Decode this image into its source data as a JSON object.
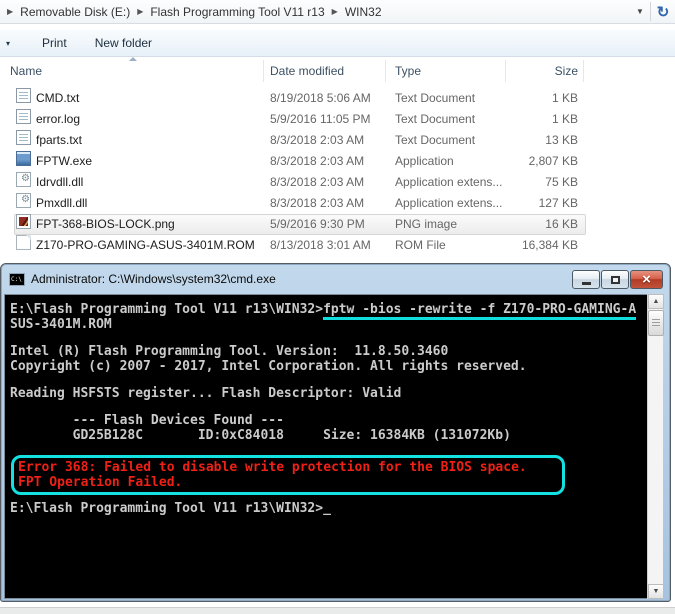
{
  "address_bar": {
    "breadcrumbs": [
      "Removable Disk (E:)",
      "Flash Programming Tool V11 r13",
      "WIN32"
    ]
  },
  "icons": {
    "breadcrumb_arrow": "▶",
    "dropdown": "▼",
    "refresh": "↻",
    "overflow_chevron": "▾",
    "scroll_up": "▲",
    "scroll_down": "▼",
    "close": "×"
  },
  "toolbar": {
    "print": "Print",
    "new_folder": "New folder"
  },
  "list": {
    "columns": [
      "Name",
      "Date modified",
      "Type",
      "Size"
    ],
    "files": [
      {
        "icon": "text",
        "name": "CMD.txt",
        "date": "8/19/2018 5:06 AM",
        "type": "Text Document",
        "size": "1 KB"
      },
      {
        "icon": "text",
        "name": "error.log",
        "date": "5/9/2016 11:05 PM",
        "type": "Text Document",
        "size": "1 KB"
      },
      {
        "icon": "text",
        "name": "fparts.txt",
        "date": "8/3/2018 2:03 AM",
        "type": "Text Document",
        "size": "13 KB"
      },
      {
        "icon": "app",
        "name": "FPTW.exe",
        "date": "8/3/2018 2:03 AM",
        "type": "Application",
        "size": "2,807 KB"
      },
      {
        "icon": "dll",
        "name": "Idrvdll.dll",
        "date": "8/3/2018 2:03 AM",
        "type": "Application extens...",
        "size": "75 KB"
      },
      {
        "icon": "dll",
        "name": "Pmxdll.dll",
        "date": "8/3/2018 2:03 AM",
        "type": "Application extens...",
        "size": "127 KB"
      },
      {
        "icon": "png",
        "name": "FPT-368-BIOS-LOCK.png",
        "date": "5/9/2016 9:30 PM",
        "type": "PNG image",
        "size": "16 KB"
      },
      {
        "icon": "rom",
        "name": "Z170-PRO-GAMING-ASUS-3401M.ROM",
        "date": "8/13/2018 3:01 AM",
        "type": "ROM File",
        "size": "16,384 KB"
      }
    ]
  },
  "cmd": {
    "title": "Administrator: C:\\Windows\\system32\\cmd.exe",
    "icon_label": "C:\\",
    "first_line": {
      "prompt": "E:\\Flash Programming Tool V11 r13\\WIN32>",
      "command": "fptw -bios -rewrite -f Z170-PRO-GAMING-A",
      "wrap": "SUS-3401M.ROM"
    },
    "output": [
      "Intel (R) Flash Programming Tool. Version:  11.8.50.3460",
      "Copyright (c) 2007 - 2017, Intel Corporation. All rights reserved.",
      "Reading HSFSTS register... Flash Descriptor: Valid",
      "        --- Flash Devices Found ---",
      "        GD25B128C       ID:0xC84018     Size: 16384KB (131072Kb)"
    ],
    "error": {
      "line1": "Error 368: Failed to disable write protection for the BIOS space.",
      "line2": "FPT Operation Failed."
    },
    "final_prompt": "E:\\Flash Programming Tool V11 r13\\WIN32>",
    "cursor": "_"
  },
  "colors": {
    "annotation_cyan": "#14e2e2",
    "error_red": "#ef2016",
    "console_text": "#cbcbcb",
    "close_button_red": "#c2523a"
  }
}
